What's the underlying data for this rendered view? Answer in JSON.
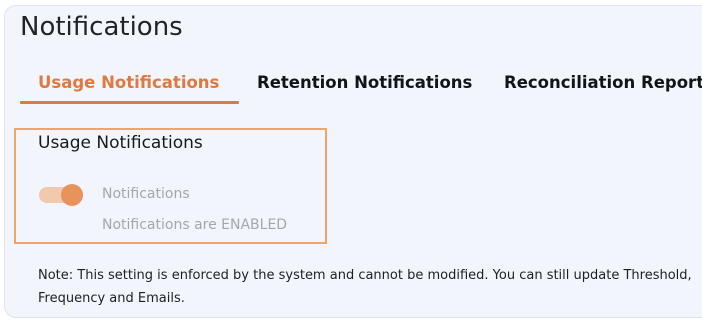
{
  "page": {
    "title": "Notifications"
  },
  "tabs": [
    {
      "label": "Usage Notifications",
      "active": true
    },
    {
      "label": "Retention Notifications",
      "active": false
    },
    {
      "label": "Reconciliation Report",
      "active": false
    }
  ],
  "usage_section": {
    "title": "Usage Notifications",
    "toggle": {
      "label": "Notifications",
      "status": "Notifications are ENABLED",
      "enabled": true,
      "disabled": true
    }
  },
  "note": "Note: This setting is enforced by the system and cannot be modified. You can still update Threshold, Frequency and Emails.",
  "colors": {
    "accent": "#e0793f",
    "panel_background": "#f2f6fc",
    "box_border": "#f0a36a",
    "toggle_track": "#f1c9ac",
    "toggle_knob": "#e8935c",
    "muted_text": "#a3a8ae"
  }
}
